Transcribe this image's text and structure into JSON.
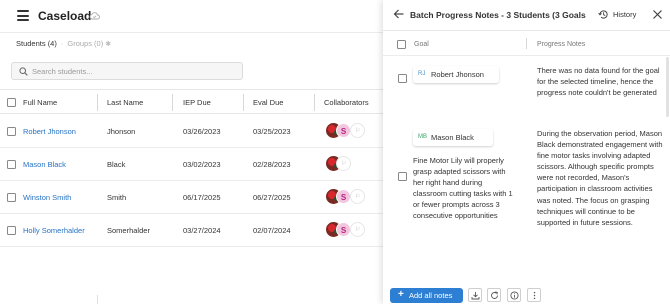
{
  "app": {
    "title": "Caseload",
    "tabs": {
      "students": "Students (4)",
      "groups": "Groups (0)"
    },
    "search_placeholder": "Search students..."
  },
  "table": {
    "headers": [
      "Full Name",
      "Last Name",
      "IEP Due",
      "Eval Due",
      "Collaborators"
    ],
    "rows": [
      {
        "full_name": "Robert Jhonson",
        "last_name": "Jhonson",
        "iep_due": "03/26/2023",
        "eval_due": "03/25/2023",
        "collab_initial": "S"
      },
      {
        "full_name": "Mason Black",
        "last_name": "Black",
        "iep_due": "03/02/2023",
        "eval_due": "02/28/2023",
        "collab_initial": ""
      },
      {
        "full_name": "Winston Smith",
        "last_name": "Smith",
        "iep_due": "06/17/2025",
        "eval_due": "06/27/2025",
        "collab_initial": "S"
      },
      {
        "full_name": "Holly Somerhalder",
        "last_name": "Somerhalder",
        "iep_due": "03/27/2024",
        "eval_due": "02/07/2024",
        "collab_initial": "S"
      }
    ]
  },
  "drawer": {
    "title": "Batch Progress Notes - 3 Students (3 Goals",
    "history_label": "History",
    "col_goal": "Goal",
    "col_notes": "Progress Notes",
    "entries": [
      {
        "initials": "RJ",
        "student": "Robert Jhonson",
        "goal": "",
        "note": "There was no data found for the goal for the selected timeline, hence the progress note couldn't be generated"
      },
      {
        "initials": "MB",
        "student": "Mason Black",
        "goal": "Fine Motor Lily will properly grasp adapted scissors with her right hand during classroom cutting tasks with 1 or fewer prompts across 3 consecutive opportunities",
        "note": "During the observation period, Mason Black demonstrated engagement with fine motor tasks involving adapted scissors. Although specific prompts were not recorded, Mason's participation in classroom activities was noted. The focus on grasping techniques will continue to be supported in future sessions."
      }
    ],
    "add_all_label": "Add all notes"
  },
  "colors": {
    "accent": "#2d7fd3",
    "link": "#2673c4",
    "rj_initials": "#4a90c9",
    "mb_initials": "#3aa56a",
    "collab_pink": "#f3c6df"
  },
  "icons": [
    "menu-icon",
    "cloud-icon",
    "search-icon",
    "back-arrow-icon",
    "history-icon",
    "close-icon",
    "download-icon",
    "refresh-icon",
    "info-icon",
    "more-icon"
  ]
}
